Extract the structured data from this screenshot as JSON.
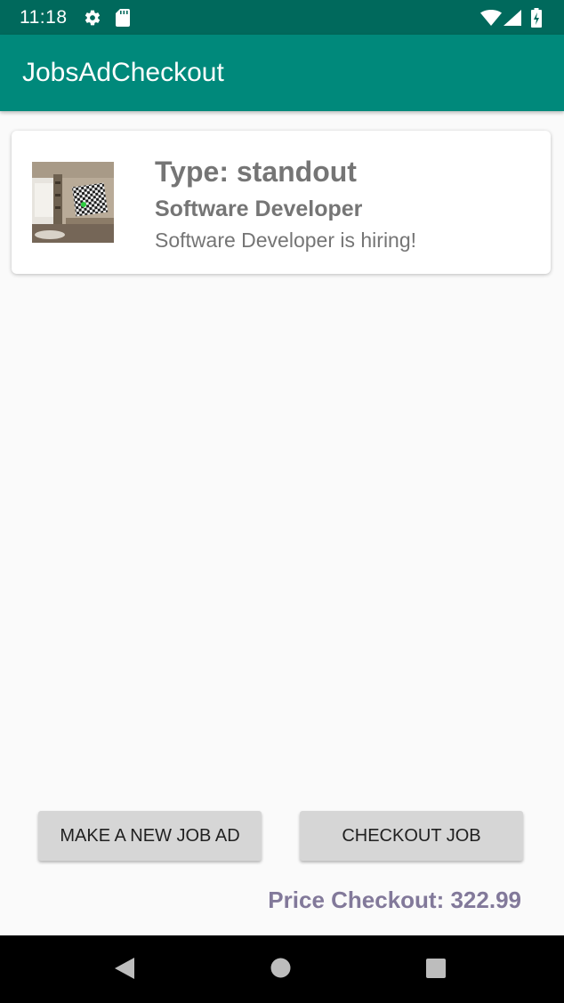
{
  "status_bar": {
    "time": "11:18",
    "icons": [
      "gear-icon",
      "sd-card-icon",
      "wifi-icon",
      "cell-signal-icon",
      "battery-charging-icon"
    ]
  },
  "app_bar": {
    "title": "JobsAdCheckout"
  },
  "job_card": {
    "image": "job-thumbnail-icon",
    "type_label": "Type: standout",
    "job_title": "Software Developer",
    "description": "Software Developer is hiring!"
  },
  "actions": {
    "new_job_ad_label": "MAKE A NEW JOB AD",
    "checkout_job_label": "CHECKOUT JOB"
  },
  "price": {
    "text": "Price Checkout: 322.99"
  },
  "nav_bar": {
    "icons": [
      "back-icon",
      "home-icon",
      "recents-icon"
    ]
  },
  "colors": {
    "status_bar": "#00695c",
    "app_bar": "#00897b",
    "price_text": "#82799a",
    "button_bg": "#d6d6d6"
  }
}
